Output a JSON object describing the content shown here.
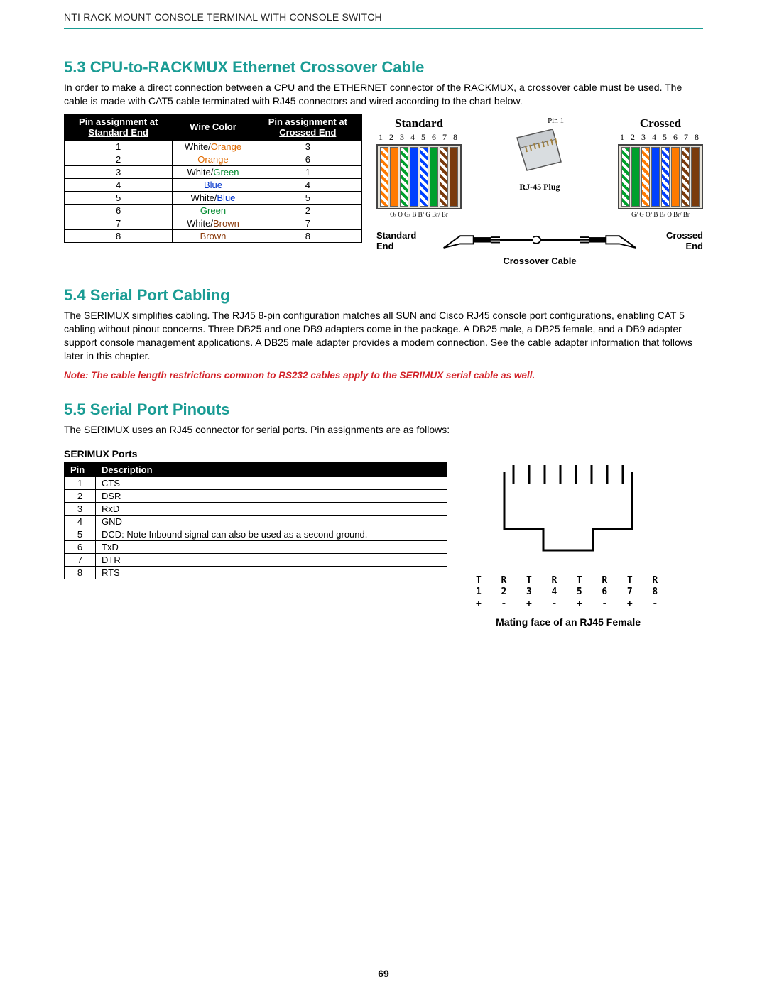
{
  "header": {
    "title": "NTI RACK MOUNT CONSOLE TERMINAL WITH CONSOLE SWITCH"
  },
  "page_number": "69",
  "section53": {
    "heading": "5.3 CPU-to-RACKMUX Ethernet Crossover Cable",
    "body": "In order to make a direct connection between a CPU and the ETHERNET connector of the RACKMUX, a crossover cable must be used.  The cable is made with CAT5 cable terminated with RJ45 connectors and wired according to the chart below.",
    "table": {
      "head": {
        "c1": "Pin assignment at",
        "c1_sub": "Standard End",
        "c2": "Wire Color",
        "c3": "Pin assignment at",
        "c3_sub": "Crossed End"
      },
      "rows": [
        {
          "std": "1",
          "wc": [
            [
              "White/",
              "black"
            ],
            [
              "Orange",
              "orange"
            ]
          ],
          "crs": "3"
        },
        {
          "std": "2",
          "wc": [
            [
              "Orange",
              "orange"
            ]
          ],
          "crs": "6"
        },
        {
          "std": "3",
          "wc": [
            [
              "White/",
              "black"
            ],
            [
              "Green",
              "green"
            ]
          ],
          "crs": "1"
        },
        {
          "std": "4",
          "wc": [
            [
              "Blue",
              "blue"
            ]
          ],
          "crs": "4"
        },
        {
          "std": "5",
          "wc": [
            [
              "White/",
              "black"
            ],
            [
              "Blue",
              "blue"
            ]
          ],
          "crs": "5"
        },
        {
          "std": "6",
          "wc": [
            [
              "Green",
              "green"
            ]
          ],
          "crs": "2"
        },
        {
          "std": "7",
          "wc": [
            [
              "White/",
              "black"
            ],
            [
              "Brown",
              "brown"
            ]
          ],
          "crs": "7"
        },
        {
          "std": "8",
          "wc": [
            [
              "Brown",
              "brown"
            ]
          ],
          "crs": "8"
        }
      ]
    },
    "diagram": {
      "standard": {
        "title": "Standard",
        "nums": "1 2 3 4 5 6 7 8",
        "colors": [
          "orange-s",
          "orange",
          "green-s",
          "blue",
          "blue-s",
          "green",
          "brown-s",
          "brown"
        ],
        "btm": "O/ O  G/ B  B/ G Br/ Br"
      },
      "plug": {
        "pin1": "Pin 1",
        "label": "RJ-45 Plug"
      },
      "crossed": {
        "title": "Crossed",
        "nums": "1 2 3 4 5 6 7 8",
        "colors": [
          "green-s",
          "green",
          "orange-s",
          "blue",
          "blue-s",
          "orange",
          "brown-s",
          "brown"
        ],
        "btm": "G/ G  O/ B  B/ O Br/ Br"
      },
      "cable": {
        "left_label": "Standard\nEnd",
        "right_label": "Crossed\nEnd",
        "caption": "Crossover Cable"
      }
    }
  },
  "section54": {
    "heading": "5.4 Serial Port Cabling",
    "body": "The SERIMUX simplifies cabling. The RJ45 8-pin configuration matches all SUN and Cisco RJ45 console port configurations, enabling CAT 5 cabling without pinout concerns. Three DB25 and one DB9 adapters come in the package. A DB25 male, a DB25 female, and a DB9 adapter support console management applications. A DB25 male adapter provides a modem connection. See the cable adapter information that follows later in this chapter.",
    "note": "Note: The cable length restrictions common to RS232 cables apply to the SERIMUX serial cable as well."
  },
  "section55": {
    "heading": "5.5 Serial Port Pinouts",
    "body": "The SERIMUX uses an RJ45 connector for serial ports. Pin assignments are as follows:",
    "table_title": "SERIMUX Ports",
    "table": {
      "head": {
        "c1": "Pin",
        "c2": "Description"
      },
      "rows": [
        {
          "pin": "1",
          "desc": "CTS"
        },
        {
          "pin": "2",
          "desc": "DSR"
        },
        {
          "pin": "3",
          "desc": "RxD"
        },
        {
          "pin": "4",
          "desc": "GND"
        },
        {
          "pin": "5",
          "desc": "DCD: Note Inbound signal can also be used as a second ground."
        },
        {
          "pin": "6",
          "desc": "TxD"
        },
        {
          "pin": "7",
          "desc": "DTR"
        },
        {
          "pin": "8",
          "desc": "RTS"
        }
      ]
    },
    "rj45_female": {
      "row1": "T  R  T  R  T  R  T  R",
      "row2": "1  2  3  4  5  6  7  8",
      "row3": "+  -  +  -  +  -  +  -",
      "caption": "Mating face of an RJ45 Female"
    }
  }
}
